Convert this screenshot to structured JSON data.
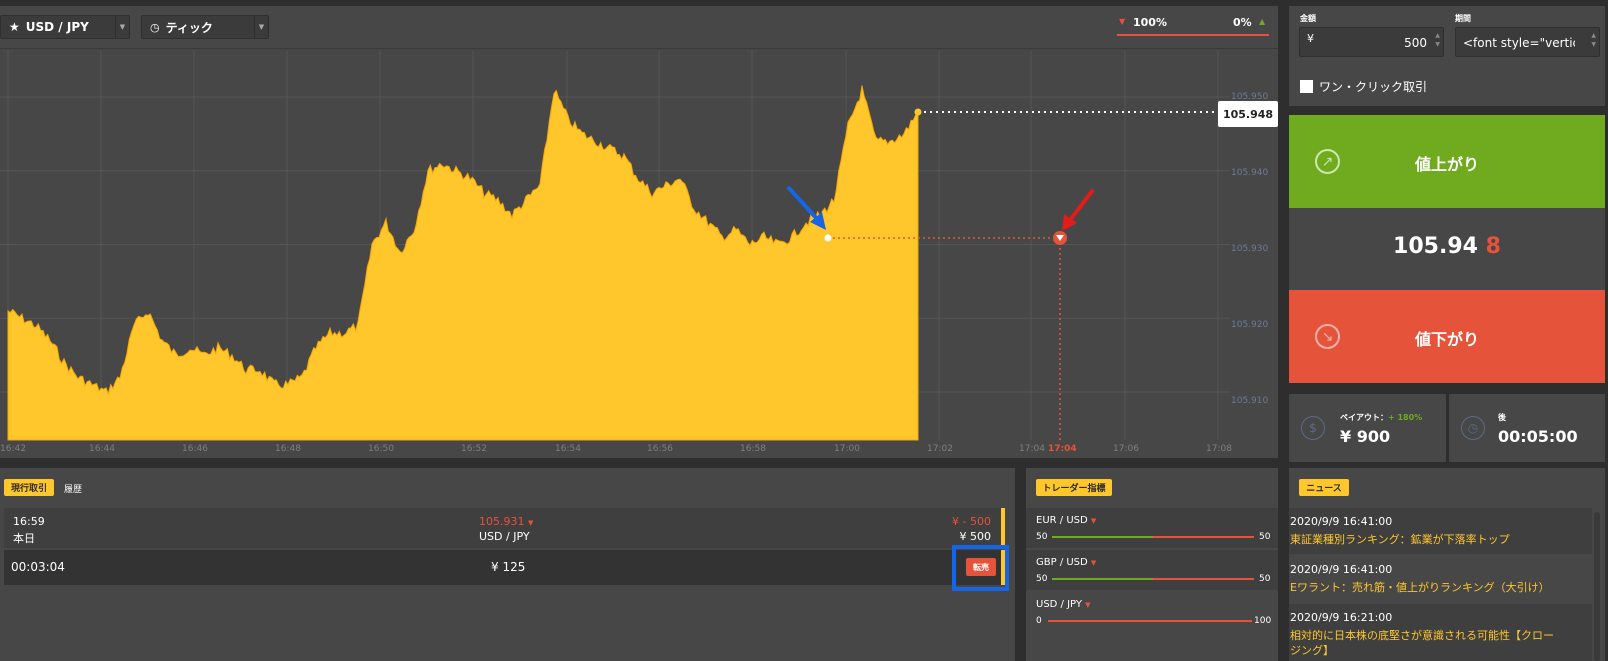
{
  "toolbar": {
    "pair": "USD / JPY",
    "mode": "ティック",
    "down_pct": "100%",
    "up_pct": "0%"
  },
  "chart_data": {
    "type": "area",
    "x_ticks": [
      "16:42",
      "16:44",
      "16:46",
      "16:48",
      "16:50",
      "16:52",
      "16:54",
      "16:56",
      "16:58",
      "17:00",
      "17:02",
      "17:04",
      "17:04",
      "17:06",
      "17:08"
    ],
    "y_ticks": [
      "105.950",
      "105.940",
      "105.930",
      "105.920",
      "105.910"
    ],
    "ylim": [
      105.905,
      105.953
    ],
    "series": [
      {
        "values": [
          105.921,
          105.92,
          105.919,
          105.917,
          105.914,
          105.912,
          105.911,
          105.91,
          105.912,
          105.919,
          105.921,
          105.917,
          105.915,
          105.916,
          105.915,
          105.916,
          105.915,
          105.913,
          105.913,
          105.911,
          105.911,
          105.912,
          105.916,
          105.918,
          105.918,
          105.919,
          105.93,
          105.933,
          105.929,
          105.932,
          105.94,
          105.941,
          105.94,
          105.939,
          105.937,
          105.936,
          105.934,
          105.936,
          105.938,
          105.951,
          105.947,
          105.945,
          105.944,
          105.943,
          105.942,
          105.939,
          105.937,
          105.938,
          105.939,
          105.935,
          105.933,
          105.931,
          105.932,
          105.93,
          105.931,
          105.93,
          105.931,
          105.933,
          105.934,
          105.936,
          105.946,
          105.951,
          105.944,
          105.944,
          105.945,
          105.948
        ]
      }
    ],
    "current_price": "105.948",
    "expiry_time": "17:04",
    "grid": true
  },
  "order": {
    "amount_label": "金額",
    "currency": "¥",
    "amount": "500",
    "period_label": "期間",
    "period_value": "<font style=\"vertic",
    "one_click_label": "ワン・クリック取引",
    "up_label": "値上がり",
    "down_label": "値下がり",
    "price_main": "105.94",
    "price_last": "8",
    "payout_label": "ペイアウト：",
    "payout_pct": "+ 180%",
    "payout_value": "¥ 900",
    "after_label": "後",
    "countdown": "00:05:00"
  },
  "trades": {
    "tab_active": "現行取引",
    "tab_history": "履歴",
    "time": "16:59",
    "day": "本日",
    "entry_price": "105.931",
    "pair": "USD / JPY",
    "stake_neg": "¥ - 500",
    "stake": "¥ 500",
    "remaining": "00:03:04",
    "resale_value": "¥ 125",
    "resale_button": "転売"
  },
  "indicators": {
    "title": "トレーダー指標",
    "items": [
      {
        "pair": "EUR / USD",
        "left": "50",
        "right": "50"
      },
      {
        "pair": "GBP / USD",
        "left": "50",
        "right": "50"
      },
      {
        "pair": "USD / JPY",
        "left": "0",
        "right": "100"
      }
    ]
  },
  "news": {
    "title": "ニュース",
    "items": [
      {
        "date": "2020/9/9 16:41:00",
        "text": "東証業種別ランキング：鉱業が下落率トップ"
      },
      {
        "date": "2020/9/9 16:41:00",
        "text": "Eワラント：売れ筋・値上がりランキング（大引け）"
      },
      {
        "date": "2020/9/9 16:21:00",
        "text": "相対的に日本株の底堅さが意識される可能性【クロージング】"
      }
    ]
  },
  "colors": {
    "area": "#ffc72c",
    "up": "#6faa1f",
    "down": "#e5533b",
    "annotation_blue": "#1565e8",
    "annotation_red": "#e21b1b"
  }
}
